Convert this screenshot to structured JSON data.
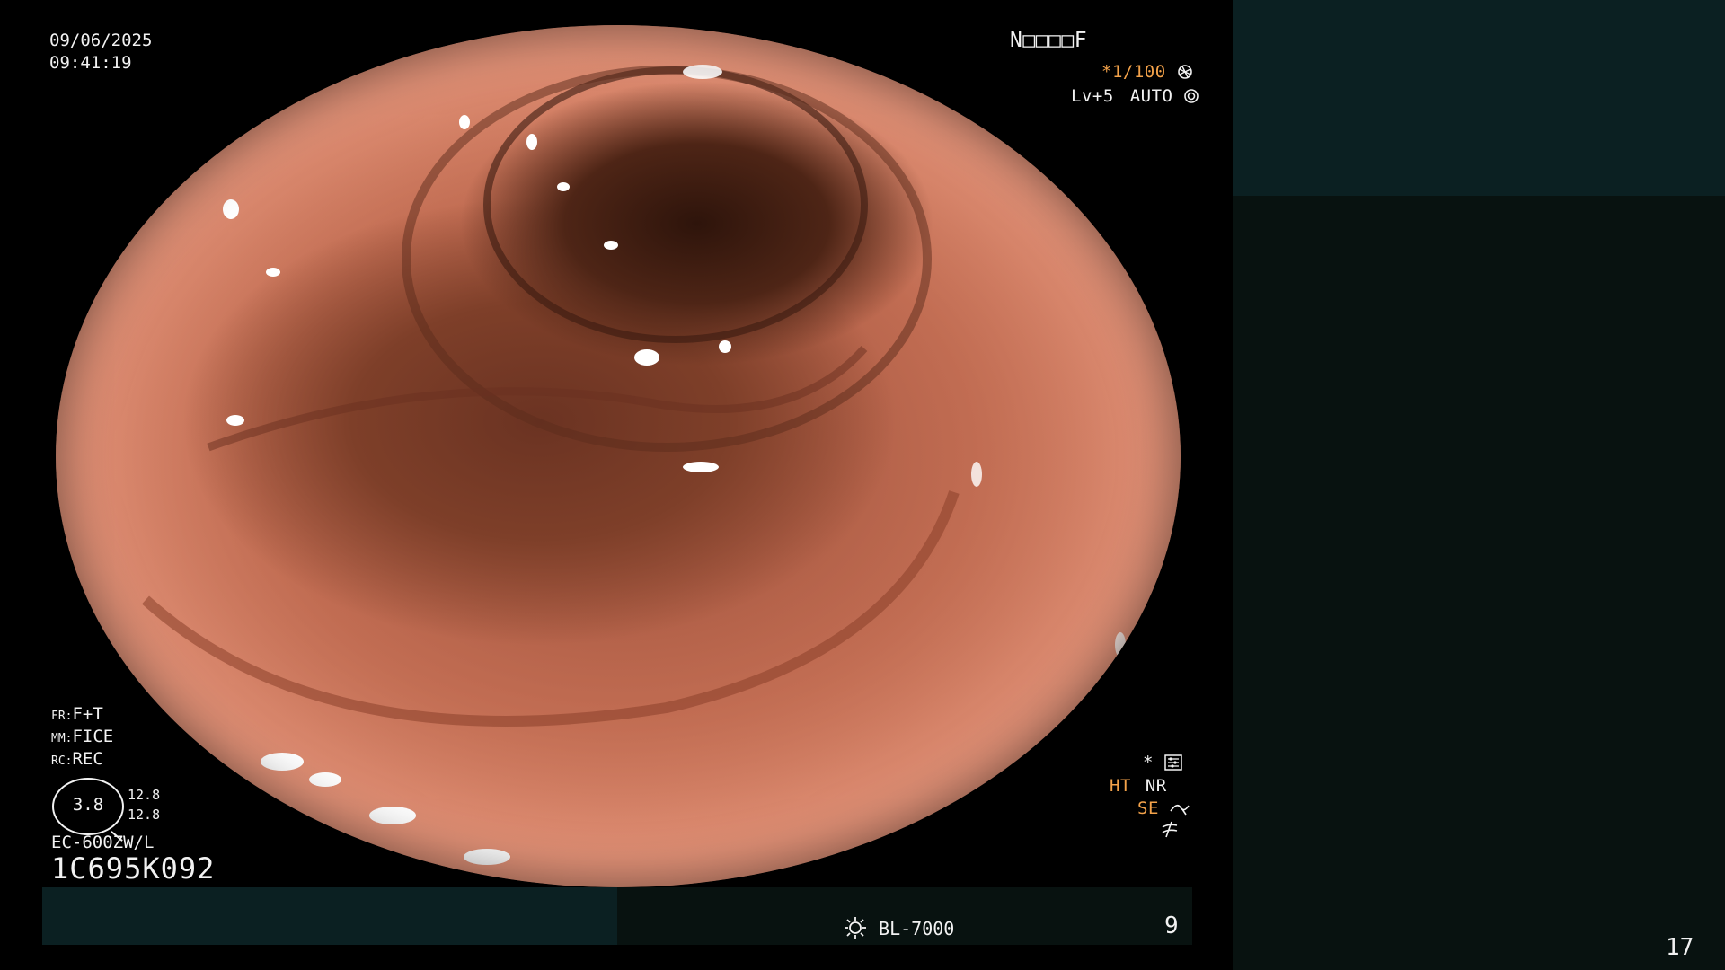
{
  "overlay": {
    "date": "09/06/2025",
    "time": "09:41:19",
    "patient_id_label": "N□□□□F",
    "shutter": "*1/100",
    "shutter_icon": "aperture-icon",
    "level": "Lv+5",
    "iris_mode": "AUTO",
    "iris_icon": "iris-icon",
    "fr_label": "FR:",
    "fr_value": "F+T",
    "mm_label": "MM:",
    "mm_value": "FICE",
    "rc_label": "RC:",
    "rc_value": "REC",
    "scope_value": "3.8",
    "scope_val_top": "12.8",
    "scope_val_bottom": "12.8",
    "scope_model": "EC-600ZW/L",
    "serial": "1C695K092",
    "settings_marker": "*",
    "settings_icon": "settings-icon",
    "ht": "HT",
    "nr": "NR",
    "se": "SE",
    "se_icon": "curve-icon",
    "structure_icon": "enhance-icon",
    "light_source": "BL-7000",
    "light_icon": "light-source-icon",
    "image_number": "9",
    "page_number": "17"
  },
  "colors": {
    "panel_dark_teal": "#0b2022",
    "panel_darker": "#081210",
    "accent_orange": "#f3a24a",
    "text": "#f2f2f2"
  }
}
